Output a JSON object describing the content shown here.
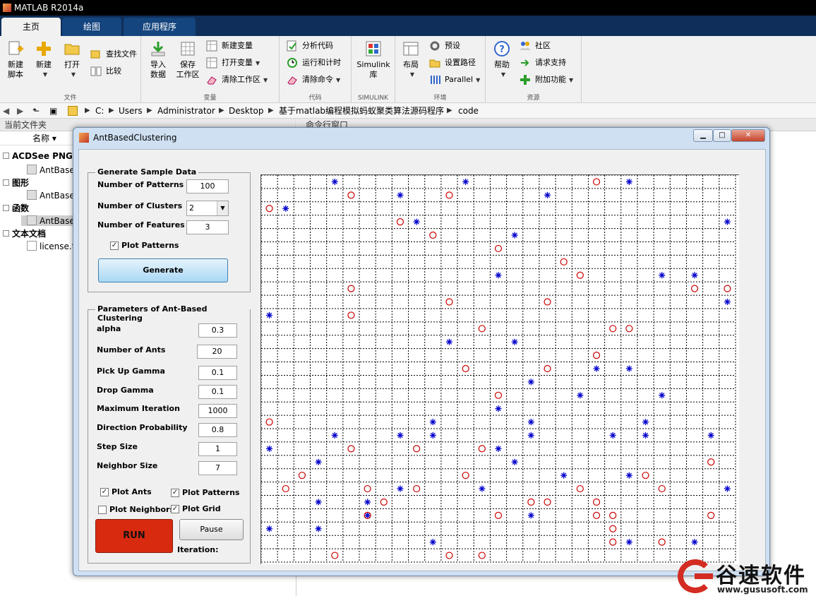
{
  "window": {
    "title": "MATLAB R2014a"
  },
  "tabs": [
    {
      "label": "主页"
    },
    {
      "label": "绘图"
    },
    {
      "label": "应用程序"
    }
  ],
  "ribbon": {
    "file": {
      "label": "文件",
      "new_script": "新建\n脚本",
      "new": "新建",
      "open": "打开",
      "find_files": "查找文件",
      "compare": "比较"
    },
    "variable": {
      "label": "变量",
      "import": "导入\n数据",
      "save": "保存\n工作区",
      "new_var": "新建变量",
      "open_var": "打开变量",
      "clear_ws": "清除工作区"
    },
    "code": {
      "label": "代码",
      "analyze": "分析代码",
      "run_time": "运行和计时",
      "clear_cmd": "清除命令"
    },
    "simulink": {
      "label": "SIMULINK",
      "lib": "Simulink\n库"
    },
    "env": {
      "label": "环境",
      "layout": "布局",
      "prefs": "预设",
      "set_path": "设置路径",
      "parallel": "Parallel"
    },
    "resources": {
      "label": "资源",
      "help": "帮助",
      "community": "社区",
      "support": "请求支持",
      "addons": "附加功能"
    }
  },
  "address": {
    "crumbs": [
      "C:",
      "Users",
      "Administrator",
      "Desktop",
      "基于matlab编程模拟蚂蚁聚类算法源码程序",
      "code"
    ]
  },
  "left_panel": {
    "title": "当前文件夹",
    "name_col": "名称",
    "groups": [
      {
        "label": "ACDSee PNG",
        "item": "AntBase"
      },
      {
        "label": "图形",
        "item": "AntBase"
      },
      {
        "label": "函数",
        "item": "AntBase"
      },
      {
        "label": "文本文档",
        "item": "license.t"
      }
    ]
  },
  "cmd_panel": {
    "title": "命令行窗口"
  },
  "dialog": {
    "title": "AntBasedClustering",
    "sample": {
      "title": "Generate Sample Data",
      "num_patterns_label": "Number of Patterns",
      "num_patterns": "100",
      "num_clusters_label": "Number of Clusters",
      "num_clusters": "2",
      "num_features_label": "Number of Features",
      "num_features": "3",
      "plot_patterns_label": "Plot Patterns",
      "generate": "Generate"
    },
    "params": {
      "title": "Parameters of Ant-Based Clustering",
      "rows": [
        {
          "label": "alpha",
          "value": "0.3"
        },
        {
          "label": "Number of Ants",
          "value": "20"
        },
        {
          "label": "Pick Up Gamma",
          "value": "0.1"
        },
        {
          "label": "Drop Gamma",
          "value": "0.1"
        },
        {
          "label": "Maximum Iteration",
          "value": "1000"
        },
        {
          "label": "Direction Probability",
          "value": "0.8"
        },
        {
          "label": "Step Size",
          "value": "1"
        },
        {
          "label": "Neighbor Size",
          "value": "7"
        }
      ],
      "plot_ants": "Plot Ants",
      "plot_patterns": "Plot Patterns",
      "plot_neighbors": "Plot Neighbors",
      "plot_grid": "Plot Grid",
      "run": "RUN",
      "pause": "Pause",
      "iteration_label": "Iteration:"
    }
  },
  "chart_data": {
    "type": "scatter",
    "grid": true,
    "grid_size": [
      29,
      29
    ],
    "xlim": [
      0,
      29
    ],
    "ylim": [
      0,
      29
    ],
    "series": [
      {
        "marker": "star",
        "color": "#0000cc",
        "points": [
          [
            4.5,
            28.5
          ],
          [
            12.5,
            28.5
          ],
          [
            22.5,
            28.5
          ],
          [
            8.5,
            27.5
          ],
          [
            17.5,
            27.5
          ],
          [
            1.5,
            26.5
          ],
          [
            9.5,
            25.5
          ],
          [
            28.5,
            25.5
          ],
          [
            15.5,
            24.5
          ],
          [
            14.5,
            21.5
          ],
          [
            24.5,
            21.5
          ],
          [
            26.5,
            21.5
          ],
          [
            28.5,
            19.5
          ],
          [
            0.5,
            18.5
          ],
          [
            11.5,
            16.5
          ],
          [
            15.5,
            16.5
          ],
          [
            20.5,
            14.5
          ],
          [
            22.5,
            14.5
          ],
          [
            16.5,
            13.5
          ],
          [
            19.5,
            12.5
          ],
          [
            24.5,
            12.5
          ],
          [
            14.5,
            11.5
          ],
          [
            10.5,
            10.5
          ],
          [
            16.5,
            10.5
          ],
          [
            23.5,
            10.5
          ],
          [
            4.5,
            9.5
          ],
          [
            8.5,
            9.5
          ],
          [
            10.5,
            9.5
          ],
          [
            16.5,
            9.5
          ],
          [
            21.5,
            9.5
          ],
          [
            23.5,
            9.5
          ],
          [
            27.5,
            9.5
          ],
          [
            0.5,
            8.5
          ],
          [
            14.5,
            8.5
          ],
          [
            3.5,
            7.5
          ],
          [
            15.5,
            7.5
          ],
          [
            18.5,
            6.5
          ],
          [
            22.5,
            6.5
          ],
          [
            8.5,
            5.5
          ],
          [
            13.5,
            5.5
          ],
          [
            28.5,
            5.5
          ],
          [
            3.5,
            4.5
          ],
          [
            6.5,
            4.5
          ],
          [
            6.5,
            3.5
          ],
          [
            16.5,
            3.5
          ],
          [
            0.5,
            2.5
          ],
          [
            3.5,
            2.5
          ],
          [
            10.5,
            1.5
          ],
          [
            22.5,
            1.5
          ],
          [
            26.5,
            1.5
          ]
        ]
      },
      {
        "marker": "circle",
        "color": "#cc0000",
        "points": [
          [
            20.5,
            28.5
          ],
          [
            5.5,
            27.5
          ],
          [
            11.5,
            27.5
          ],
          [
            0.5,
            26.5
          ],
          [
            8.5,
            25.5
          ],
          [
            10.5,
            24.5
          ],
          [
            14.5,
            23.5
          ],
          [
            18.5,
            22.5
          ],
          [
            19.5,
            21.5
          ],
          [
            5.5,
            20.5
          ],
          [
            26.5,
            20.5
          ],
          [
            28.5,
            20.5
          ],
          [
            11.5,
            19.5
          ],
          [
            17.5,
            19.5
          ],
          [
            5.5,
            18.5
          ],
          [
            13.5,
            17.5
          ],
          [
            21.5,
            17.5
          ],
          [
            22.5,
            17.5
          ],
          [
            20.5,
            15.5
          ],
          [
            12.5,
            14.5
          ],
          [
            17.5,
            14.5
          ],
          [
            14.5,
            12.5
          ],
          [
            0.5,
            10.5
          ],
          [
            5.5,
            8.5
          ],
          [
            9.5,
            8.5
          ],
          [
            13.5,
            8.5
          ],
          [
            27.5,
            7.5
          ],
          [
            2.5,
            6.5
          ],
          [
            12.5,
            6.5
          ],
          [
            23.5,
            6.5
          ],
          [
            1.5,
            5.5
          ],
          [
            6.5,
            5.5
          ],
          [
            9.5,
            5.5
          ],
          [
            19.5,
            5.5
          ],
          [
            24.5,
            5.5
          ],
          [
            7.5,
            4.5
          ],
          [
            16.5,
            4.5
          ],
          [
            17.5,
            4.5
          ],
          [
            20.5,
            4.5
          ],
          [
            6.5,
            3.5
          ],
          [
            14.5,
            3.5
          ],
          [
            20.5,
            3.5
          ],
          [
            21.5,
            3.5
          ],
          [
            27.5,
            3.5
          ],
          [
            21.5,
            2.5
          ],
          [
            21.5,
            1.5
          ],
          [
            4.5,
            0.5
          ],
          [
            11.5,
            0.5
          ],
          [
            13.5,
            0.5
          ],
          [
            24.5,
            1.5
          ]
        ]
      }
    ]
  },
  "watermark": {
    "text": "谷速软件",
    "url": "www.gususoft.com"
  }
}
